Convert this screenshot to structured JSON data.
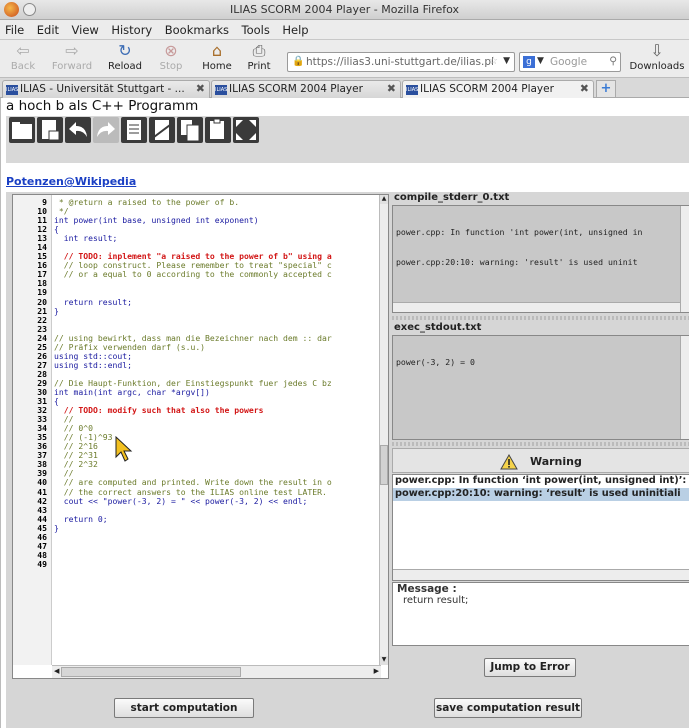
{
  "window": {
    "title": "ILIAS SCORM 2004 Player - Mozilla Firefox"
  },
  "menu": [
    "File",
    "Edit",
    "View",
    "History",
    "Bookmarks",
    "Tools",
    "Help"
  ],
  "nav": {
    "back": "Back",
    "forward": "Forward",
    "reload": "Reload",
    "stop": "Stop",
    "home": "Home",
    "print": "Print",
    "url": "https://ilias3.uni-stuttgart.de/ilias.pl",
    "search_engine": "Google",
    "downloads": "Downloads"
  },
  "tabs": [
    {
      "label": "ILIAS - Universität Stuttgart - ..."
    },
    {
      "label": "ILIAS SCORM 2004 Player"
    },
    {
      "label": "ILIAS SCORM 2004 Player"
    }
  ],
  "page": {
    "title": "a hoch b als C++ Programm",
    "link": "Potenzen@Wikipedia"
  },
  "code_lines": [
    {
      "n": "9",
      "t": " * @return a raised to the power of b.",
      "k": "comment"
    },
    {
      "n": "10",
      "t": " */",
      "k": "comment"
    },
    {
      "n": "11",
      "t": "int power(int base, unsigned int exponent)",
      "k": "code"
    },
    {
      "n": "12",
      "t": "{",
      "k": "code"
    },
    {
      "n": "13",
      "t": "  int result;",
      "k": "code"
    },
    {
      "n": "14",
      "t": "",
      "k": "code"
    },
    {
      "n": "15",
      "t": "  // TODO: inplement \"a raised to the power of b\" using a",
      "k": "todo"
    },
    {
      "n": "16",
      "t": "  // loop construct. Please remember to treat \"special\" c",
      "k": "comment"
    },
    {
      "n": "17",
      "t": "  // or a equal to 0 according to the commonly accepted c",
      "k": "comment"
    },
    {
      "n": "18",
      "t": "",
      "k": "code"
    },
    {
      "n": "19",
      "t": "",
      "k": "code"
    },
    {
      "n": "20",
      "t": "  return result;",
      "k": "code"
    },
    {
      "n": "21",
      "t": "}",
      "k": "code"
    },
    {
      "n": "22",
      "t": "",
      "k": "code"
    },
    {
      "n": "23",
      "t": "",
      "k": "code"
    },
    {
      "n": "24",
      "t": "// using bewirkt, dass man die Bezeichner nach dem :: dar",
      "k": "comment"
    },
    {
      "n": "25",
      "t": "// Präfix verwenden darf (s.u.)",
      "k": "comment"
    },
    {
      "n": "26",
      "t": "using std::cout;",
      "k": "code"
    },
    {
      "n": "27",
      "t": "using std::endl;",
      "k": "code"
    },
    {
      "n": "28",
      "t": "",
      "k": "code"
    },
    {
      "n": "29",
      "t": "// Die Haupt-Funktion, der Einstiegspunkt fuer jedes C bz",
      "k": "comment"
    },
    {
      "n": "30",
      "t": "int main(int argc, char *argv[])",
      "k": "code"
    },
    {
      "n": "31",
      "t": "{",
      "k": "code"
    },
    {
      "n": "32",
      "t": "  // TODO: modify such that also the powers",
      "k": "todo"
    },
    {
      "n": "33",
      "t": "  //",
      "k": "comment"
    },
    {
      "n": "34",
      "t": "  // 0^0",
      "k": "comment"
    },
    {
      "n": "35",
      "t": "  // (-1)^93",
      "k": "comment"
    },
    {
      "n": "36",
      "t": "  // 2^16",
      "k": "comment"
    },
    {
      "n": "37",
      "t": "  // 2^31",
      "k": "comment"
    },
    {
      "n": "38",
      "t": "  // 2^32",
      "k": "comment"
    },
    {
      "n": "39",
      "t": "  //",
      "k": "comment"
    },
    {
      "n": "40",
      "t": "  // are computed and printed. Write down the result in o",
      "k": "comment"
    },
    {
      "n": "41",
      "t": "  // the correct answers to the ILIAS online test LATER.",
      "k": "comment"
    },
    {
      "n": "42",
      "t": "  cout << \"power(-3, 2) = \" << power(-3, 2) << endl;",
      "k": "code"
    },
    {
      "n": "43",
      "t": "",
      "k": "code"
    },
    {
      "n": "44",
      "t": "  return 0;",
      "k": "code"
    },
    {
      "n": "45",
      "t": "}",
      "k": "code"
    },
    {
      "n": "46",
      "t": "",
      "k": "code"
    },
    {
      "n": "47",
      "t": "",
      "k": "code"
    },
    {
      "n": "48",
      "t": "",
      "k": "code"
    },
    {
      "n": "49",
      "t": "",
      "k": "code"
    }
  ],
  "compile_panel": {
    "title": "compile_stderr_0.txt",
    "lines": [
      "power.cpp: In function 'int power(int, unsigned in",
      "power.cpp:20:10: warning: 'result' is used uninit"
    ]
  },
  "exec_panel": {
    "title": "exec_stdout.txt",
    "lines": [
      "power(-3, 2) = 0"
    ]
  },
  "warnings": {
    "header": "Warning",
    "items": [
      "power.cpp: In function ‘int power(int, unsigned int)’:",
      "power.cpp:20:10: warning: ‘result’ is used uninitiali"
    ],
    "message_label": "Message :",
    "message_value": "return result;",
    "jump_button": "Jump to Error"
  },
  "buttons": {
    "start": "start computation",
    "save": "save computation result"
  }
}
